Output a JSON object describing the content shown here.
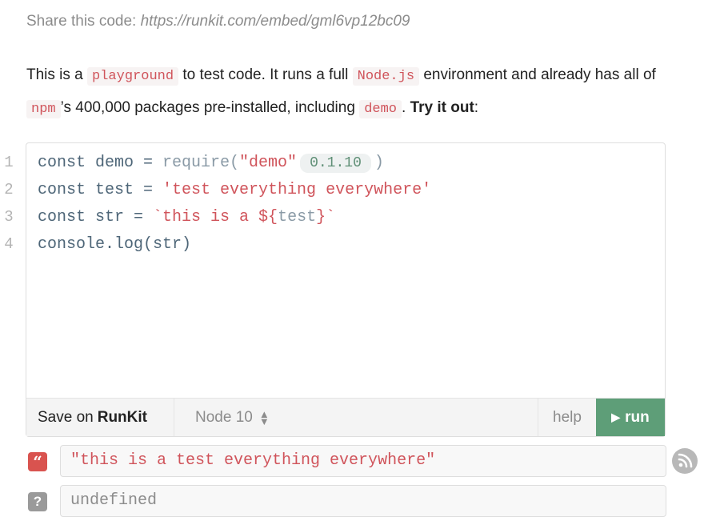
{
  "share": {
    "label": "Share this code:",
    "url": "https://runkit.com/embed/gml6vp12bc09"
  },
  "description": {
    "t1": "This is a",
    "token_playground": "playground",
    "t2": "to test code. It runs a full",
    "token_node": "Node.js",
    "t3": "environment and already has all of",
    "token_npm": "npm",
    "t4": "’s 400,000 packages pre-installed, including",
    "token_demo": "demo",
    "t5": ".",
    "cta": "Try it out",
    "colon": ":"
  },
  "editor": {
    "line_numbers": [
      "1",
      "2",
      "3",
      "4"
    ],
    "lines": {
      "l1_a": "const demo = ",
      "l1_req": "require(",
      "l1_str": "\"demo\"",
      "l1_version": "0.1.10",
      "l1_close": ")",
      "l2_a": "const test = ",
      "l2_str": "'test everything everywhere'",
      "l3_a": "const str = ",
      "l3_s1": "`this is a ${",
      "l3_var": "test",
      "l3_s2": "}`",
      "l4": "console.log(str)"
    }
  },
  "toolbar": {
    "save_prefix": "Save on",
    "save_brand": "RunKit",
    "node_version": "Node 10",
    "help_label": "help",
    "run_label": "run"
  },
  "outputs": [
    {
      "badge": "“",
      "text": "\"this is a test everything everywhere\""
    },
    {
      "badge": "?",
      "text": "undefined"
    }
  ],
  "colors": {
    "accent_run": "#5e9e78",
    "string": "#d0545b",
    "code": "#4e6678"
  },
  "icons": [
    "quote-icon",
    "question-icon",
    "rss-icon",
    "play-icon",
    "up-down-arrows-icon"
  ]
}
